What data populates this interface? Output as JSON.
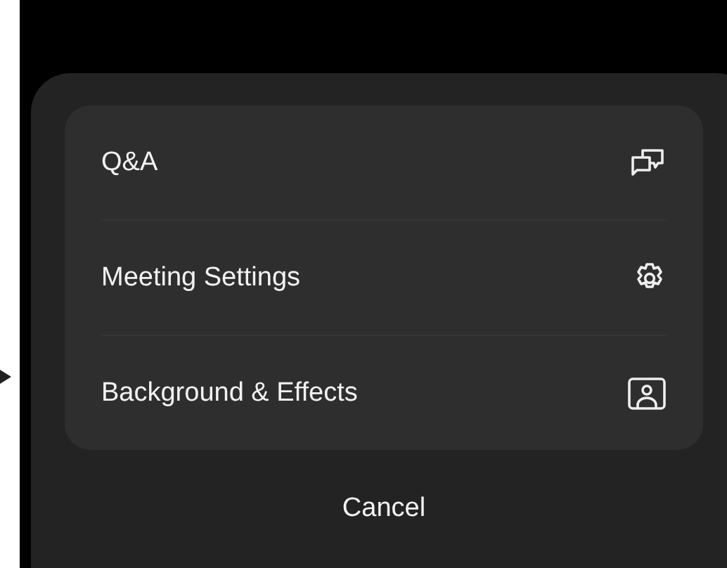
{
  "menu": {
    "items": [
      {
        "label": "Q&A",
        "kind": "chat"
      },
      {
        "label": "Meeting Settings",
        "kind": "gear"
      },
      {
        "label": "Background & Effects",
        "kind": "portrait"
      }
    ]
  },
  "cancel": "Cancel"
}
